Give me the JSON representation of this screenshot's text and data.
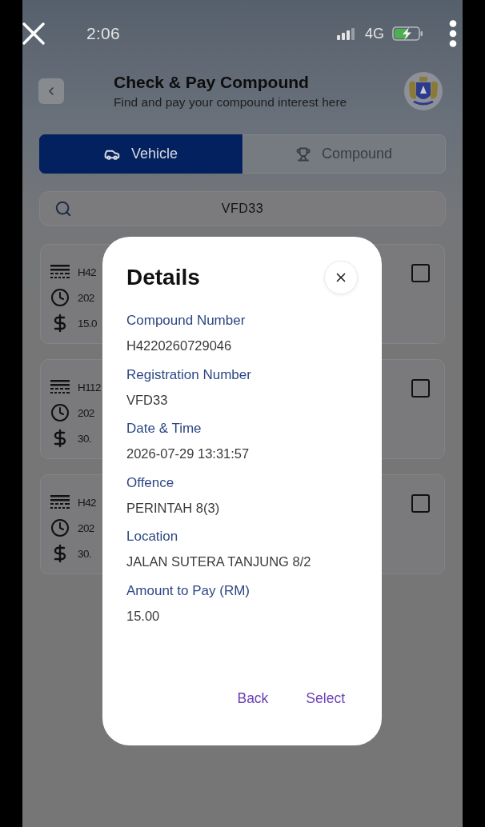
{
  "status_bar": {
    "time": "2:06",
    "network": "4G"
  },
  "header": {
    "title": "Check & Pay Compound",
    "subtitle": "Find and pay your compound interest here"
  },
  "tabs": [
    {
      "label": "Vehicle",
      "kind": "vehicle",
      "selected": true
    },
    {
      "label": "Compound",
      "kind": "compound",
      "selected": false
    }
  ],
  "search": {
    "value": "VFD33"
  },
  "cards": [
    {
      "compound_number": "H42",
      "date_time": "202",
      "amount": "15.0",
      "checked": false
    },
    {
      "compound_number": "H112",
      "date_time": "202",
      "amount": "30.",
      "checked": false
    },
    {
      "compound_number": "H42",
      "date_time": "202",
      "amount": "30.",
      "checked": false
    }
  ],
  "dialog": {
    "title": "Details",
    "fields": [
      {
        "label": "Compound Number",
        "value": "H4220260729046"
      },
      {
        "label": "Registration Number",
        "value": "VFD33"
      },
      {
        "label": "Date & Time",
        "value": "2026-07-29 13:31:57"
      },
      {
        "label": "Offence",
        "value": "PERINTAH 8(3)"
      },
      {
        "label": "Location",
        "value": "JALAN SUTERA TANJUNG 8/2"
      },
      {
        "label": "Amount to Pay (RM)",
        "value": "15.00"
      }
    ],
    "buttons": [
      "Back",
      "Select"
    ]
  }
}
